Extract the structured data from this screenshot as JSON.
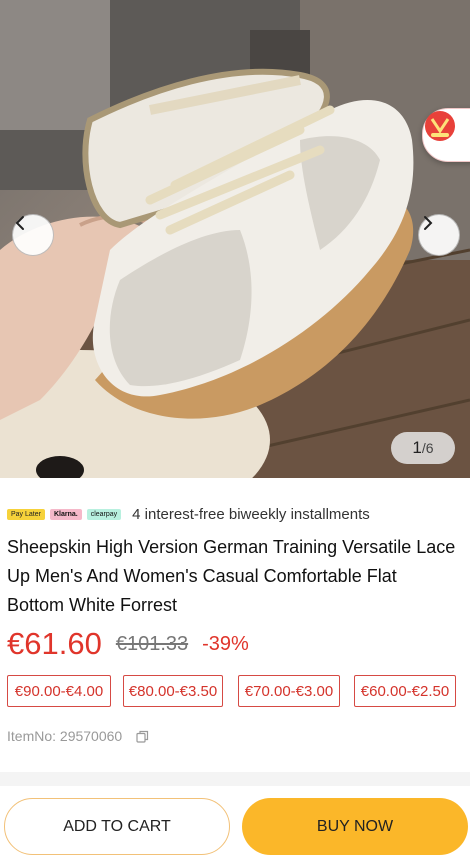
{
  "gallery": {
    "current": "1",
    "total": "/6",
    "image_alt": "Sheepskin sneakers held in hand",
    "promo_badge_icon": "promo-badge-icon"
  },
  "payment": {
    "logos": [
      "Pay Later",
      "Klarna.",
      "clearpay"
    ],
    "text": "4 interest-free biweekly installments"
  },
  "product": {
    "title": "Sheepskin High Version German Training Versatile Lace Up Men's And Women's Casual Comfortable Flat Bottom White Forrest",
    "price": "€61.60",
    "original_price": "€101.33",
    "discount": "-39%",
    "tiers": [
      "€90.00-€4.00",
      "€80.00-€3.50",
      "€70.00-€3.00",
      "€60.00-€2.50"
    ],
    "item_no": "ItemNo: 29570060"
  },
  "actions": {
    "add_to_cart": "ADD TO CART",
    "buy_now": "BUY NOW"
  },
  "colors": {
    "price_red": "#e0352b",
    "buy_yellow": "#fbb729",
    "cart_border": "#f2c178"
  }
}
